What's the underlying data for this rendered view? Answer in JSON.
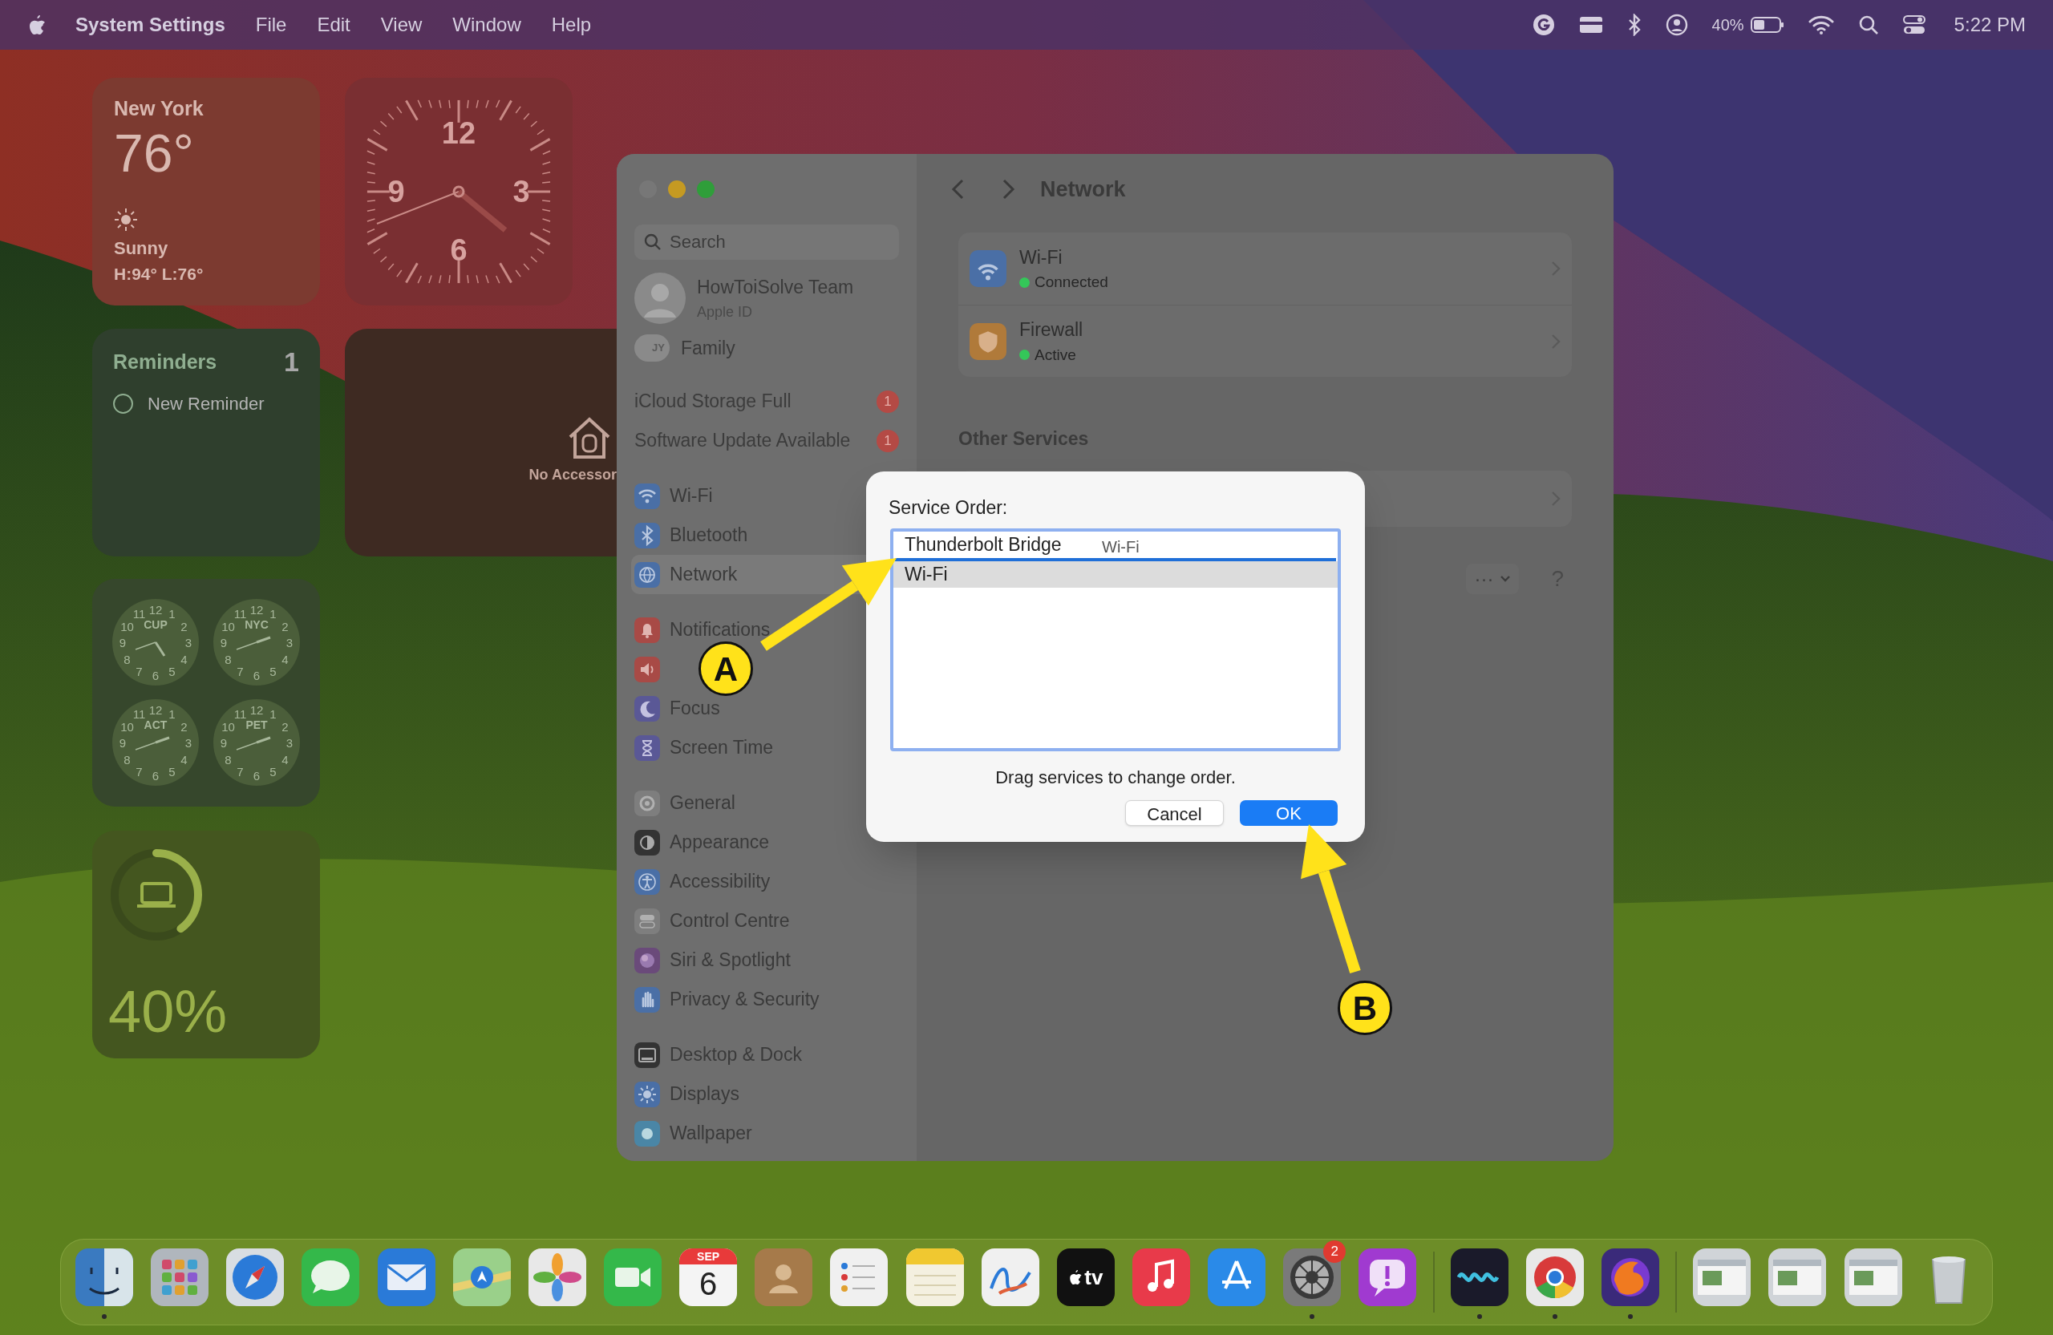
{
  "menu_bar": {
    "app_name": "System Settings",
    "menus": [
      "File",
      "Edit",
      "View",
      "Window",
      "Help"
    ],
    "battery_text": "40%",
    "time": "5:22 PM"
  },
  "widgets": {
    "weather": {
      "city": "New York",
      "temperature": "76°",
      "condition": "Sunny",
      "high_low": "H:94° L:76°"
    },
    "clock": {
      "numerals": [
        "12",
        "3",
        "6",
        "9"
      ]
    },
    "reminders": {
      "title": "Reminders",
      "count": "1",
      "items": [
        {
          "text": "New Reminder",
          "checked": false
        }
      ]
    },
    "home": {
      "text": "No Accessor"
    },
    "world_clocks": [
      {
        "city": "CUP",
        "numerals": [
          "11",
          "12",
          "1",
          "10",
          "2",
          "9",
          "3",
          "8",
          "4",
          "7",
          "6",
          "5"
        ]
      },
      {
        "city": "NYC",
        "numerals": [
          "11",
          "12",
          "1",
          "10",
          "2",
          "9",
          "3",
          "8",
          "4",
          "7",
          "6",
          "5"
        ]
      },
      {
        "city": "ACT",
        "numerals": [
          "11",
          "12",
          "1",
          "10",
          "2",
          "9",
          "3",
          "8",
          "4",
          "7",
          "6",
          "5"
        ]
      },
      {
        "city": "PET",
        "numerals": [
          "11",
          "12",
          "1",
          "10",
          "2",
          "9",
          "3",
          "8",
          "4",
          "7",
          "6",
          "5"
        ]
      }
    ],
    "battery": {
      "level": 0.4,
      "text": "40%"
    }
  },
  "settings": {
    "sidebar": {
      "search_placeholder": "Search",
      "account": {
        "name": "HowToiSolve Team",
        "subtitle": "Apple ID"
      },
      "family": {
        "initials": "JY",
        "label": "Family"
      },
      "alerts": [
        {
          "label": "iCloud Storage Full",
          "badge": "1"
        },
        {
          "label": "Software Update Available",
          "badge": "1"
        }
      ],
      "groups": [
        {
          "items": [
            {
              "kind": "wifi",
              "label": "Wi-Fi",
              "selected": false
            },
            {
              "kind": "bluetooth",
              "label": "Bluetooth",
              "selected": false
            },
            {
              "kind": "network",
              "label": "Network",
              "selected": true
            }
          ]
        },
        {
          "items": [
            {
              "kind": "notifications",
              "label": "Notifications",
              "selected": false
            },
            {
              "kind": "sound",
              "selected": false
            },
            {
              "kind": "focus",
              "label": "Focus",
              "selected": false
            },
            {
              "kind": "screentime",
              "label": "Screen Time",
              "selected": false
            }
          ]
        },
        {
          "items": [
            {
              "kind": "general",
              "label": "General",
              "selected": false
            },
            {
              "kind": "appearance",
              "label": "Appearance",
              "selected": false
            },
            {
              "kind": "accessibility",
              "label": "Accessibility",
              "selected": false
            },
            {
              "kind": "controlcentre",
              "label": "Control Centre",
              "selected": false
            },
            {
              "kind": "siri",
              "label": "Siri & Spotlight",
              "selected": false
            },
            {
              "kind": "privacy",
              "label": "Privacy & Security",
              "selected": false
            }
          ]
        },
        {
          "items": [
            {
              "kind": "desktop",
              "label": "Desktop & Dock",
              "selected": false
            },
            {
              "kind": "displays",
              "label": "Displays",
              "selected": false
            },
            {
              "kind": "wallpaper",
              "label": "Wallpaper",
              "selected": false
            }
          ]
        }
      ]
    },
    "content": {
      "title": "Network",
      "services": [
        {
          "kind": "wifi",
          "name": "Wi-Fi",
          "status": "Connected",
          "color": "#34c759"
        },
        {
          "kind": "firewall",
          "name": "Firewall",
          "status": "Active",
          "color": "#34c759"
        }
      ],
      "section": "Other Services",
      "more_glyph": "···",
      "help_glyph": "?"
    }
  },
  "dialog": {
    "label": "Service Order:",
    "services": [
      {
        "name": "Thunderbolt Bridge",
        "selected": false,
        "drop_target": true
      },
      {
        "name": "Wi-Fi",
        "selected": true,
        "drop_target": false
      }
    ],
    "drag_ghost": "Wi-Fi",
    "hint": "Drag services to change order.",
    "buttons": [
      {
        "kind": "cancel",
        "label": "Cancel"
      },
      {
        "kind": "default",
        "label": "OK"
      }
    ]
  },
  "annotations": [
    {
      "label": "A"
    },
    {
      "label": "B"
    }
  ],
  "dock": {
    "items": [
      {
        "kind": "finder",
        "running": true
      },
      {
        "kind": "launchpad",
        "running": false
      },
      {
        "kind": "safari",
        "running": false
      },
      {
        "kind": "messages",
        "running": false
      },
      {
        "kind": "mail",
        "running": false
      },
      {
        "kind": "maps",
        "running": false
      },
      {
        "kind": "photos",
        "running": false
      },
      {
        "kind": "facetime",
        "running": false
      },
      {
        "kind": "calendar",
        "month": "SEP",
        "day": "6",
        "running": false
      },
      {
        "kind": "contacts",
        "running": false
      },
      {
        "kind": "reminders",
        "running": false
      },
      {
        "kind": "notes",
        "running": false
      },
      {
        "kind": "freeform",
        "running": false
      },
      {
        "kind": "tv",
        "text": "tv",
        "running": false
      },
      {
        "kind": "music",
        "running": false
      },
      {
        "kind": "appstore",
        "running": false
      },
      {
        "kind": "settings",
        "badge": "2",
        "running": true
      },
      {
        "kind": "feedback",
        "running": false
      },
      {
        "kind": "separator"
      },
      {
        "kind": "wave",
        "running": true
      },
      {
        "kind": "chrome",
        "running": true
      },
      {
        "kind": "firefox",
        "running": true
      },
      {
        "kind": "separator"
      },
      {
        "kind": "window"
      },
      {
        "kind": "window"
      },
      {
        "kind": "window"
      },
      {
        "kind": "trash"
      }
    ]
  }
}
